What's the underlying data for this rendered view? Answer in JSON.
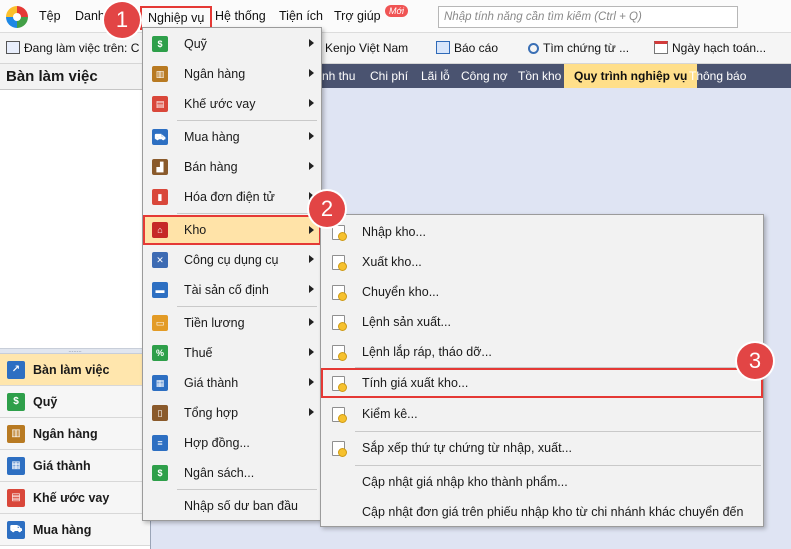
{
  "menubar": {
    "items": [
      "Tệp",
      "Danh",
      "Nghiệp vụ",
      "Hệ thống",
      "Tiện ích",
      "Trợ giúp"
    ],
    "new_badge": "Mới",
    "search_placeholder": "Nhập tính năng cần tìm kiếm (Ctrl + Q)"
  },
  "toolbar": {
    "working_on": "Đang làm việc trên: C",
    "company": "Kenjo Việt Nam",
    "report": "Báo cáo",
    "find_voucher": "Tìm chứng từ ...",
    "posting_date": "Ngày hạch toán..."
  },
  "left_panel": {
    "title": "Bàn làm việc",
    "splitter": "........",
    "nav": [
      "Bàn làm việc",
      "Quỹ",
      "Ngân hàng",
      "Giá thành",
      "Khế ước vay",
      "Mua hàng"
    ]
  },
  "tabs": [
    "nh thu",
    "Chi phí",
    "Lãi lỗ",
    "Công nợ",
    "Tồn kho",
    "Quy trình nghiệp vụ",
    "Thông báo"
  ],
  "dropdown": {
    "items": [
      "Quỹ",
      "Ngân hàng",
      "Khế ước vay",
      "Mua hàng",
      "Bán hàng",
      "Hóa đơn điện tử",
      "Kho",
      "Công cụ dụng cụ",
      "Tài sản cố định",
      "Tiền lương",
      "Thuế",
      "Giá thành",
      "Tổng hợp",
      "Hợp đồng...",
      "Ngân sách...",
      "Nhập số dư ban đầu"
    ]
  },
  "submenu": {
    "items": [
      "Nhập kho...",
      "Xuất kho...",
      "Chuyển kho...",
      "Lệnh sản xuất...",
      "Lệnh lắp ráp, tháo dỡ...",
      "Tính giá xuất kho...",
      "Kiểm kê...",
      "Sắp xếp thứ tự chứng từ nhập, xuất...",
      "Cập nhật giá nhập kho thành phẩm...",
      "Cập nhật đơn giá trên phiếu nhập kho từ chi nhánh khác chuyển đến"
    ]
  },
  "callouts": [
    "1",
    "2",
    "3"
  ],
  "colors": {
    "accent_red": "#e53935",
    "tab_bar": "#4a5370",
    "highlight": "#ffe3a8"
  }
}
